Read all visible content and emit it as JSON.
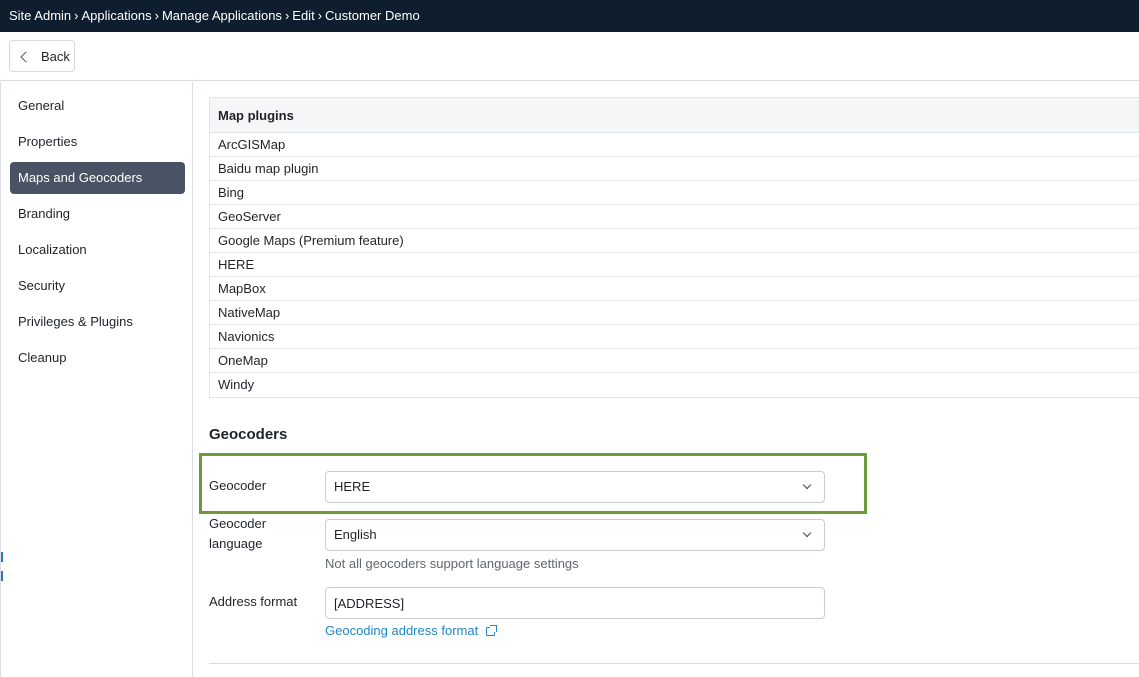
{
  "breadcrumb": [
    "Site Admin",
    "Applications",
    "Manage Applications",
    "Edit",
    "Customer Demo"
  ],
  "breadcrumb_separator": "›",
  "toolbar": {
    "back_label": "Back"
  },
  "sidebar": {
    "items": [
      {
        "label": "General",
        "active": false
      },
      {
        "label": "Properties",
        "active": false
      },
      {
        "label": "Maps and Geocoders",
        "active": true
      },
      {
        "label": "Branding",
        "active": false
      },
      {
        "label": "Localization",
        "active": false
      },
      {
        "label": "Security",
        "active": false
      },
      {
        "label": "Privileges & Plugins",
        "active": false
      },
      {
        "label": "Cleanup",
        "active": false
      }
    ]
  },
  "map_plugins": {
    "header": "Map plugins",
    "rows": [
      "ArcGISMap",
      "Baidu map plugin",
      "Bing",
      "GeoServer",
      "Google Maps (Premium feature)",
      "HERE",
      "MapBox",
      "NativeMap",
      "Navionics",
      "OneMap",
      "Windy"
    ]
  },
  "geocoders": {
    "title": "Geocoders",
    "geocoder_label": "Geocoder",
    "geocoder_value": "HERE",
    "language_label_line1": "Geocoder",
    "language_label_line2": "language",
    "language_value": "English",
    "language_hint": "Not all geocoders support language settings",
    "address_label": "Address format",
    "address_value": "[ADDRESS]",
    "address_link": "Geocoding address format"
  },
  "colors": {
    "topbar_bg": "#0f1e2e",
    "active_nav_bg": "#4a5363",
    "highlight_border": "#6f9a3a",
    "link": "#1f88c8"
  }
}
